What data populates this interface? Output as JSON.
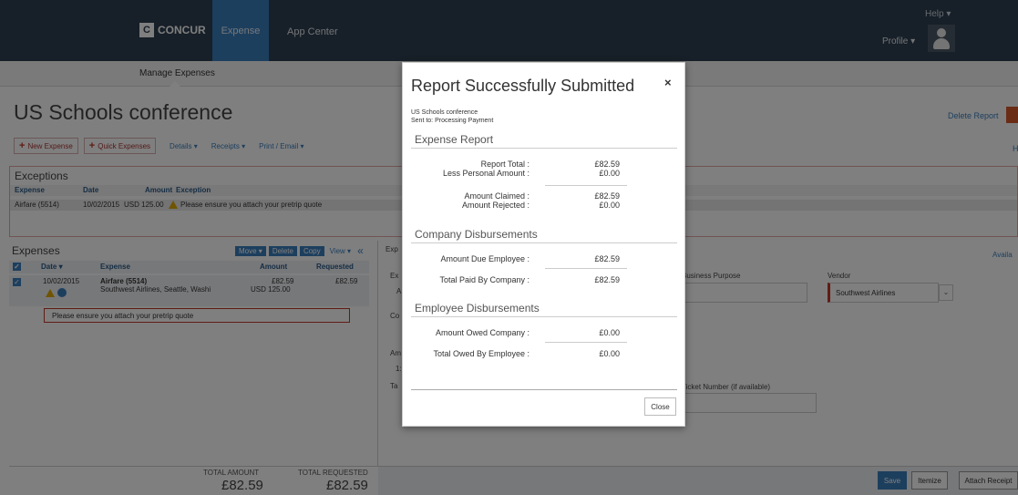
{
  "header": {
    "brand": "CONCUR",
    "brand_mark": "C",
    "nav_expense": "Expense",
    "nav_app_center": "App Center",
    "help": "Help ▾",
    "profile": "Profile ▾"
  },
  "subnav": {
    "manage_expenses": "Manage Expenses"
  },
  "report": {
    "title": "US Schools conference",
    "delete_report": "Delete Report",
    "edge_h": "H"
  },
  "actions": {
    "new_expense": "New Expense",
    "quick_expenses": "Quick Expenses",
    "details": "Details ▾",
    "receipts": "Receipts ▾",
    "print_email": "Print / Email ▾"
  },
  "exceptions": {
    "title": "Exceptions",
    "headers": [
      "Expense",
      "Date",
      "Amount",
      "Exception"
    ],
    "row": {
      "expense": "Airfare (5514)",
      "date": "10/02/2015",
      "amount": "USD 125.00",
      "exception": "Please ensure you attach your pretrip quote"
    }
  },
  "expenses": {
    "title": "Expenses",
    "toolbar": {
      "move": "Move ▾",
      "delete": "Delete",
      "copy": "Copy",
      "view": "View ▾",
      "collapse": "«"
    },
    "headers": {
      "date": "Date ▾",
      "expense": "Expense",
      "amount": "Amount",
      "requested": "Requested"
    },
    "row": {
      "date": "10/02/2015",
      "name": "Airfare (5514)",
      "detail": "Southwest Airlines, Seattle, Washi",
      "amount": "£82.59",
      "amount_orig": "USD 125.00",
      "requested": "£82.59"
    },
    "note": "Please ensure you attach your pretrip quote",
    "total_amount_label": "TOTAL AMOUNT",
    "total_amount": "£82.59",
    "total_requested_label": "TOTAL REQUESTED",
    "total_requested": "£82.59"
  },
  "detail": {
    "tab": "Exp",
    "availa": "Availa",
    "business_purpose": "Business Purpose",
    "vendor_label": "Vendor",
    "vendor_value": "Southwest Airlines",
    "ticket_number": "Ticket Number (if available)",
    "partial_ex": "Ex",
    "partial_a": "A",
    "partial_co": "Co",
    "partial_am": "Am",
    "partial_1": "1:",
    "partial_ta": "Ta"
  },
  "footer": {
    "save": "Save",
    "itemize": "Itemize",
    "attach_receipt": "Attach Receipt"
  },
  "modal": {
    "title": "Report Successfully Submitted",
    "close_x": "×",
    "report_name": "US Schools conference",
    "sent_to": "Sent to: Processing Payment",
    "section_report": "Expense Report",
    "report_total_label": "Report Total :",
    "report_total": "£82.59",
    "less_personal_label": "Less Personal Amount :",
    "less_personal": "£0.00",
    "amount_claimed_label": "Amount Claimed :",
    "amount_claimed": "£82.59",
    "amount_rejected_label": "Amount Rejected :",
    "amount_rejected": "£0.00",
    "section_company": "Company Disbursements",
    "due_employee_label": "Amount Due Employee :",
    "due_employee": "£82.59",
    "paid_company_label": "Total Paid By Company :",
    "paid_company": "£82.59",
    "section_employee": "Employee Disbursements",
    "owed_company_label": "Amount Owed Company :",
    "owed_company": "£0.00",
    "owed_employee_label": "Total Owed By Employee :",
    "owed_employee": "£0.00",
    "close_button": "Close"
  }
}
